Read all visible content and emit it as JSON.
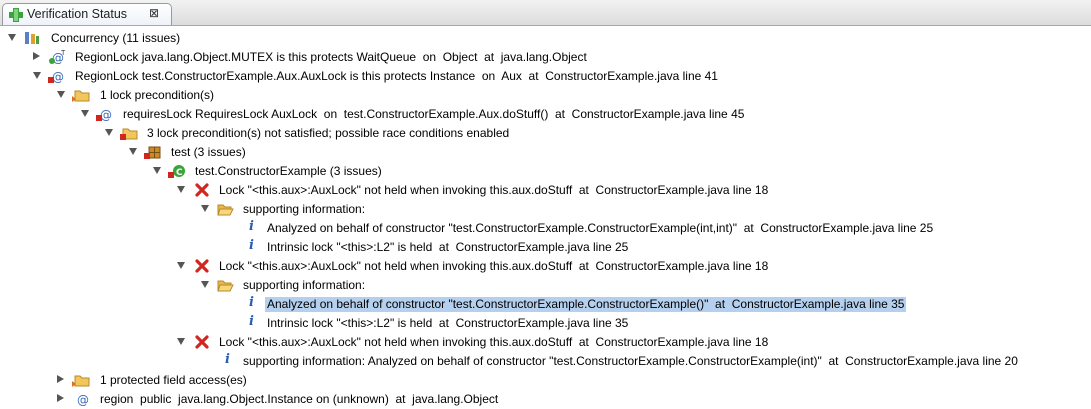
{
  "tab": {
    "title": "Verification Status",
    "close": "⊠"
  },
  "rows": [
    {
      "label": "Concurrency (11 issues)",
      "icon": "concurrency-icon",
      "twisty": "expanded",
      "selected": false
    },
    {
      "label": "RegionLock java.lang.Object.MUTEX is this protects WaitQueue  on  Object  at  java.lang.Object",
      "icon": "region-lock-annotation-icon",
      "twisty": "collapsed",
      "selected": false
    },
    {
      "label": "RegionLock test.ConstructorExample.Aux.AuxLock is this protects Instance  on  Aux  at  ConstructorExample.java line 41",
      "icon": "region-lock-failed-icon",
      "twisty": "expanded",
      "selected": false
    },
    {
      "label": "1 lock precondition(s)",
      "icon": "folder-precondition-icon",
      "twisty": "expanded",
      "selected": false
    },
    {
      "label": "requiresLock RequiresLock AuxLock  on  test.ConstructorExample.Aux.doStuff()  at  ConstructorExample.java line 45",
      "icon": "requires-lock-failed-icon",
      "twisty": "expanded",
      "selected": false
    },
    {
      "label": "3 lock precondition(s) not satisfied; possible race conditions enabled",
      "icon": "folder-precondition-failed-icon",
      "twisty": "expanded",
      "selected": false
    },
    {
      "label": "test (3 issues)",
      "icon": "package-icon",
      "twisty": "expanded",
      "selected": false
    },
    {
      "label": "test.ConstructorExample (3 issues)",
      "icon": "class-icon",
      "twisty": "expanded",
      "selected": false
    },
    {
      "label": "Lock \"<this.aux>:AuxLock\" not held when invoking this.aux.doStuff  at  ConstructorExample.java line 18",
      "icon": "error-icon",
      "twisty": "expanded",
      "selected": false
    },
    {
      "label": "supporting information:",
      "icon": "folder-open-icon",
      "twisty": "expanded",
      "selected": false
    },
    {
      "label": "Analyzed on behalf of constructor \"test.ConstructorExample.ConstructorExample(int,int)\"  at  ConstructorExample.java line 25",
      "icon": "info-icon",
      "twisty": "none",
      "selected": false
    },
    {
      "label": "Intrinsic lock \"<this>:L2\" is held  at  ConstructorExample.java line 25",
      "icon": "info-icon",
      "twisty": "none",
      "selected": false
    },
    {
      "label": "Lock \"<this.aux>:AuxLock\" not held when invoking this.aux.doStuff  at  ConstructorExample.java line 18",
      "icon": "error-icon",
      "twisty": "expanded",
      "selected": false
    },
    {
      "label": "supporting information:",
      "icon": "folder-open-icon",
      "twisty": "expanded",
      "selected": false
    },
    {
      "label": "Analyzed on behalf of constructor \"test.ConstructorExample.ConstructorExample()\"  at  ConstructorExample.java line 35",
      "icon": "info-icon",
      "twisty": "none",
      "selected": true
    },
    {
      "label": "Intrinsic lock \"<this>:L2\" is held  at  ConstructorExample.java line 35",
      "icon": "info-icon",
      "twisty": "none",
      "selected": false
    },
    {
      "label": "Lock \"<this.aux>:AuxLock\" not held when invoking this.aux.doStuff  at  ConstructorExample.java line 18",
      "icon": "error-icon",
      "twisty": "expanded",
      "selected": false
    },
    {
      "label": "supporting information: Analyzed on behalf of constructor \"test.ConstructorExample.ConstructorExample(int)\"  at  ConstructorExample.java line 20",
      "icon": "info-icon",
      "twisty": "none",
      "selected": false
    },
    {
      "label": "1 protected field access(es)",
      "icon": "folder-field-access-icon",
      "twisty": "collapsed",
      "selected": false
    },
    {
      "label": "region  public  java.lang.Object.Instance on (unknown)  at  java.lang.Object",
      "icon": "region-icon",
      "twisty": "collapsed",
      "selected": false
    }
  ],
  "colors": {
    "selection": "#b5d0ee",
    "error": "#d0261f",
    "info": "#2a5db0",
    "folder": "#f2c65a"
  }
}
